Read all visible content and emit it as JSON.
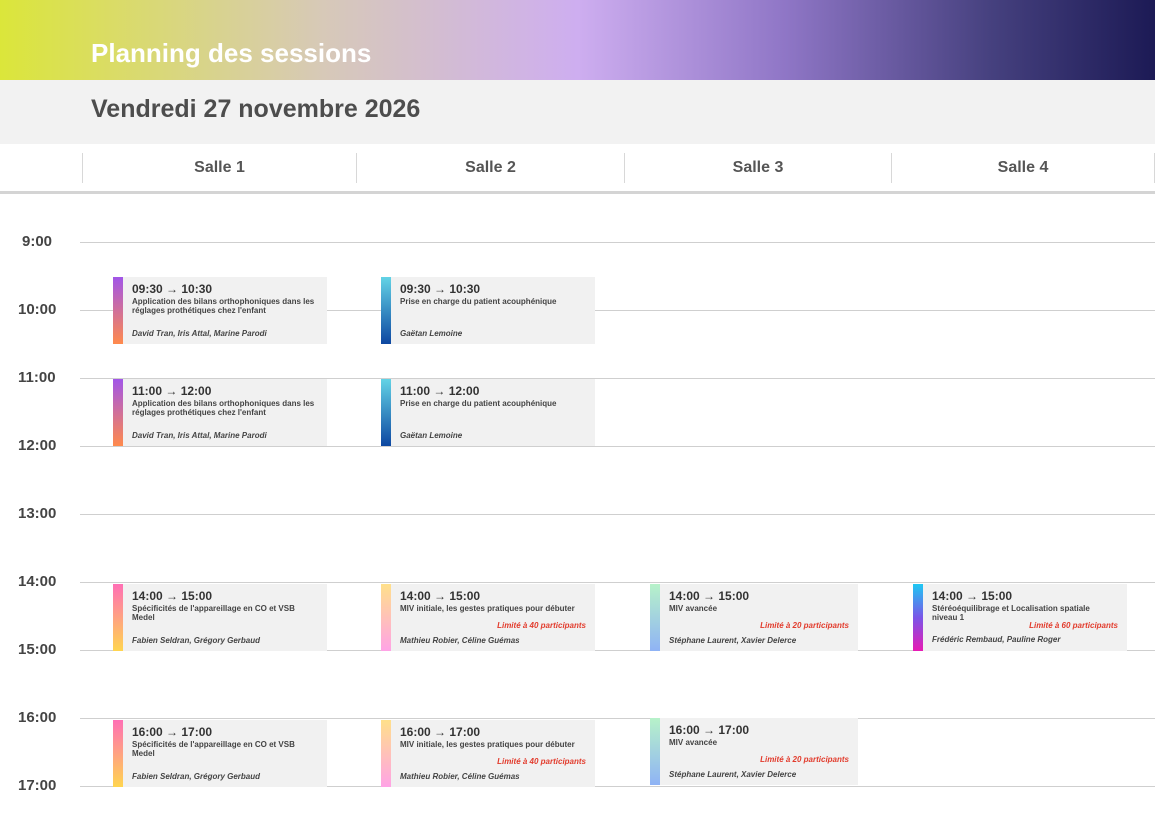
{
  "header": {
    "title": "Planning des sessions"
  },
  "date": "Vendredi 27 novembre 2026",
  "rooms": [
    "Salle 1",
    "Salle 2",
    "Salle 3",
    "Salle 4"
  ],
  "hours": [
    "9:00",
    "10:00",
    "11:00",
    "12:00",
    "13:00",
    "14:00",
    "15:00",
    "16:00",
    "17:00"
  ],
  "colors": {
    "limit_text": "#e23b2c",
    "bar_orthophonie": [
      "#a155e8",
      "#ff8a4c"
    ],
    "bar_acouphene": [
      "#63d3e6",
      "#0d47a1"
    ],
    "bar_appareillage": [
      "#ff6fb5",
      "#ffd54f"
    ],
    "bar_miv_initiale": [
      "#ffe08a",
      "#ffa3e6"
    ],
    "bar_miv_avancee": [
      "#b7f2c9",
      "#8fb3f5"
    ],
    "bar_stereo": [
      "#1ec8f3",
      "#7a55e8",
      "#e81ab4"
    ]
  },
  "events": [
    {
      "room": 0,
      "time": "09:30 → 10:30",
      "title": "Application des bilans orthophoniques dans les réglages prothétiques chez l'enfant",
      "limit": "",
      "speakers": "David Tran, Iris Attal, Marine Parodi",
      "bar": "orthophonie"
    },
    {
      "room": 1,
      "time": "09:30 → 10:30",
      "title": "Prise en charge du patient acouphénique",
      "limit": "",
      "speakers": "Gaëtan Lemoine",
      "bar": "acouphene"
    },
    {
      "room": 0,
      "time": "11:00 → 12:00",
      "title": "Application des bilans orthophoniques dans les réglages prothétiques chez l'enfant",
      "limit": "",
      "speakers": "David Tran, Iris Attal, Marine Parodi",
      "bar": "orthophonie"
    },
    {
      "room": 1,
      "time": "11:00 → 12:00",
      "title": "Prise en charge du patient acouphénique",
      "limit": "",
      "speakers": "Gaëtan Lemoine",
      "bar": "acouphene"
    },
    {
      "room": 0,
      "time": "14:00 → 15:00",
      "title": "Spécificités de l'appareillage en CO et VSB Medel",
      "limit": "",
      "speakers": "Fabien Seldran, Grégory Gerbaud",
      "bar": "appareillage"
    },
    {
      "room": 1,
      "time": "14:00 → 15:00",
      "title": "MIV initiale, les gestes pratiques pour débuter",
      "limit": "Limité à 40 participants",
      "speakers": "Mathieu Robier, Céline Guémas",
      "bar": "miv_initiale"
    },
    {
      "room": 2,
      "time": "14:00 → 15:00",
      "title": "MIV avancée",
      "limit": "Limité à 20 participants",
      "speakers": "Stéphane Laurent, Xavier Delerce",
      "bar": "miv_avancee"
    },
    {
      "room": 3,
      "time": "14:00 → 15:00",
      "title": "Stéréoéquilibrage et Localisation spatiale niveau 1",
      "limit": "Limité à 60 participants",
      "speakers": "Frédéric Rembaud, Pauline Roger",
      "bar": "stereo"
    },
    {
      "room": 0,
      "time": "16:00 → 17:00",
      "title": "Spécificités de l'appareillage en CO et VSB Medel",
      "limit": "",
      "speakers": "Fabien Seldran, Grégory Gerbaud",
      "bar": "appareillage"
    },
    {
      "room": 1,
      "time": "16:00 → 17:00",
      "title": "MIV initiale, les gestes pratiques pour débuter",
      "limit": "Limité à 40 participants",
      "speakers": "Mathieu Robier, Céline Guémas",
      "bar": "miv_initiale"
    },
    {
      "room": 2,
      "time": "16:00 → 17:00",
      "title": "MIV avancée",
      "limit": "Limité à 20 participants",
      "speakers": "Stéphane Laurent, Xavier Delerce",
      "bar": "miv_avancee"
    }
  ]
}
